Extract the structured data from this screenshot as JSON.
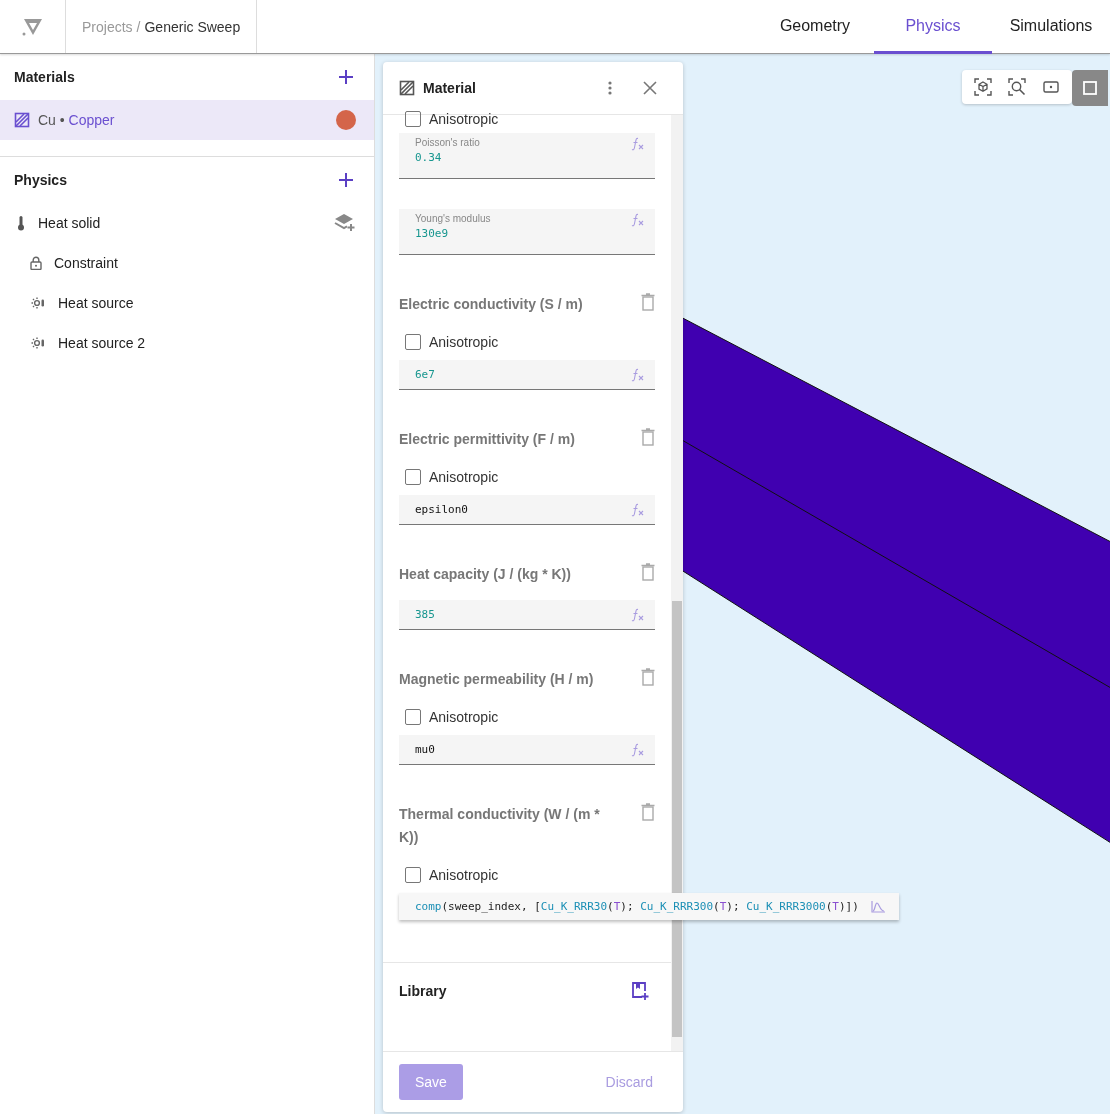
{
  "breadcrumb": {
    "parent": "Projects",
    "separator": "/",
    "current": "Generic Sweep"
  },
  "tabs": [
    {
      "label": "Geometry",
      "selected": false
    },
    {
      "label": "Physics",
      "selected": true
    },
    {
      "label": "Simulations",
      "selected": false
    }
  ],
  "materials": {
    "title": "Materials",
    "items": [
      {
        "symbol": "Cu",
        "separator": "•",
        "name": "Copper",
        "selected": true,
        "color": "#d4654a"
      }
    ]
  },
  "physics": {
    "title": "Physics",
    "items": [
      {
        "label": "Heat solid",
        "kind": "thermometer",
        "children": [
          {
            "label": "Constraint",
            "kind": "lock"
          },
          {
            "label": "Heat source",
            "kind": "source"
          },
          {
            "label": "Heat source 2",
            "kind": "source"
          }
        ]
      }
    ]
  },
  "panel": {
    "title": "Material",
    "properties": [
      {
        "anisotropic": {
          "label": "Anisotropic",
          "checked": false
        },
        "fields": [
          {
            "label": "Poisson's ratio",
            "value": "0.34",
            "kind": "number"
          },
          {
            "label": "Young's modulus",
            "value": "130e9",
            "kind": "number"
          }
        ]
      },
      {
        "title": "Electric conductivity (S / m)",
        "anisotropic": {
          "label": "Anisotropic",
          "checked": false
        },
        "fields": [
          {
            "value": "6e7",
            "kind": "number"
          }
        ]
      },
      {
        "title": "Electric permittivity (F / m)",
        "anisotropic": {
          "label": "Anisotropic",
          "checked": false
        },
        "fields": [
          {
            "value": "epsilon0",
            "kind": "symbol"
          }
        ]
      },
      {
        "title": "Heat capacity (J / (kg * K))",
        "fields": [
          {
            "value": "385",
            "kind": "number"
          }
        ]
      },
      {
        "title": "Magnetic permeability (H / m)",
        "anisotropic": {
          "label": "Anisotropic",
          "checked": false
        },
        "fields": [
          {
            "value": "mu0",
            "kind": "symbol"
          }
        ]
      },
      {
        "title": "Thermal conductivity (W / (m * K))",
        "anisotropic": {
          "label": "Anisotropic",
          "checked": false
        },
        "fields": [
          {
            "kind": "expression",
            "tokens": [
              {
                "text": "comp",
                "kind": "function"
              },
              {
                "text": "(sweep_index, [",
                "kind": "plain"
              },
              {
                "text": "Cu_K_RRR30",
                "kind": "function"
              },
              {
                "text": "(",
                "kind": "plain"
              },
              {
                "text": "T",
                "kind": "variable"
              },
              {
                "text": "); ",
                "kind": "plain"
              },
              {
                "text": "Cu_K_RRR300",
                "kind": "function"
              },
              {
                "text": "(",
                "kind": "plain"
              },
              {
                "text": "T",
                "kind": "variable"
              },
              {
                "text": "); ",
                "kind": "plain"
              },
              {
                "text": "Cu_K_RRR3000",
                "kind": "function"
              },
              {
                "text": "(",
                "kind": "plain"
              },
              {
                "text": "T",
                "kind": "variable"
              },
              {
                "text": ")])",
                "kind": "plain"
              }
            ]
          }
        ]
      }
    ],
    "library": "Library",
    "save": {
      "label": "Save",
      "disabled": true
    },
    "discard": {
      "label": "Discard",
      "disabled": true
    }
  }
}
